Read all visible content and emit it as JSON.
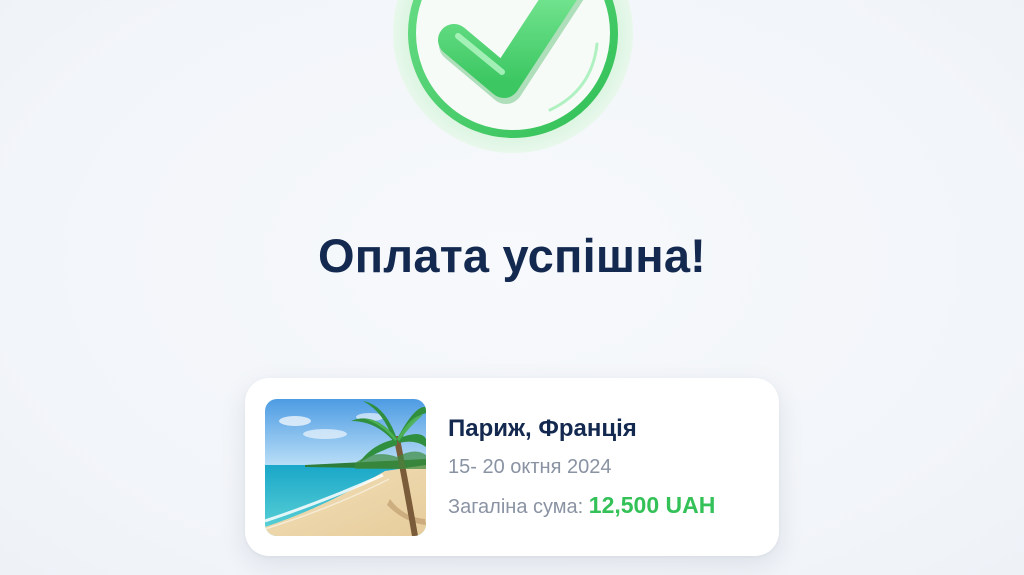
{
  "status": {
    "title": "Оплата успішна!",
    "icon": "check-circle-icon",
    "accent_color": "#34c158",
    "title_color": "#14294f"
  },
  "booking": {
    "image": "beach-palm-image",
    "destination": "Париж, Франція",
    "dates": "15- 20 октня 2024",
    "total_label": "Загаліна сума:",
    "total_amount": "12,500 UAH"
  }
}
